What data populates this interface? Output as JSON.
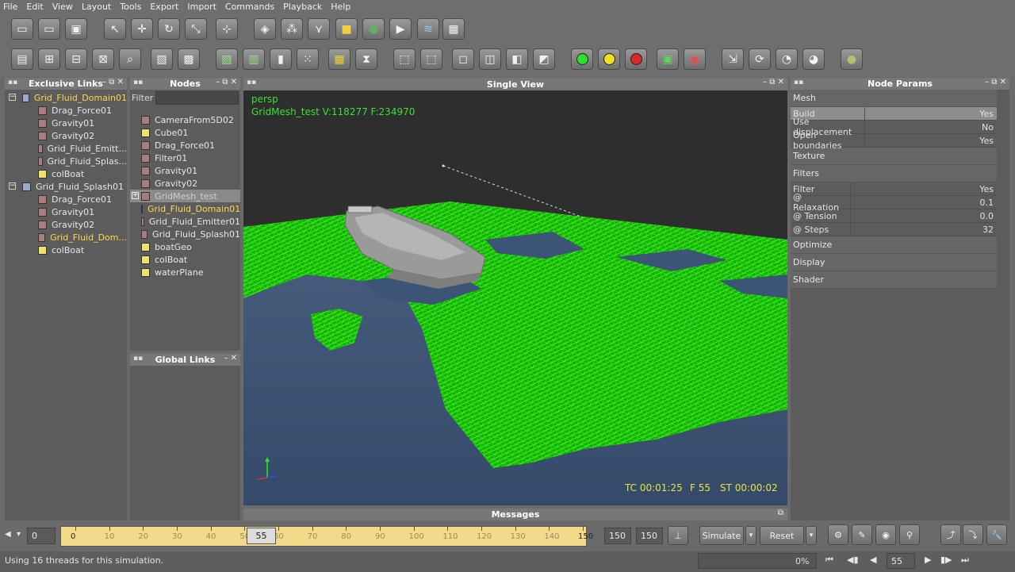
{
  "menu": [
    "File",
    "Edit",
    "View",
    "Layout",
    "Tools",
    "Export",
    "Import",
    "Commands",
    "Playback",
    "Help"
  ],
  "toolbar1_icons": [
    "new-file-icon",
    "open-folder-icon",
    "save-icon",
    "select-arrow-icon",
    "move-icon",
    "rotate-icon",
    "scale-icon",
    "axis-icon",
    "cube-wire-icon",
    "particles-icon",
    "gravity-icon",
    "cube-yellow-icon",
    "sphere-icon",
    "camera-icon",
    "layers-icon",
    "grid-cube-icon"
  ],
  "toolbar2_icons": [
    "table-icon",
    "add-icon",
    "remove-icon",
    "align-icon",
    "zoom-icon",
    "box-icon",
    "box-solid-icon",
    "mesh-icon",
    "grid-icon",
    "panel-icon",
    "dots-icon",
    "cube-grid-icon",
    "hourglass-icon",
    "frame-icon",
    "frame-dashed-icon",
    "view-front-icon",
    "view-side-icon",
    "view-top-icon",
    "view-persp-icon"
  ],
  "colors": {
    "green_light": "#2ee02e",
    "yellow_light": "#f0e020",
    "red_light": "#d82a2a",
    "mesh_green": "#27ff0a",
    "water": "#3c5474",
    "timeline": "#f3d98a"
  },
  "panels": {
    "exclusive_links": {
      "title": "Exclusive Links",
      "groups": [
        {
          "label": "Grid_Fluid_Domain01",
          "items": [
            "Drag_Force01",
            "Gravity01",
            "Gravity02",
            "Grid_Fluid_Emitt...",
            "Grid_Fluid_Splas...",
            "colBoat"
          ]
        },
        {
          "label": "Grid_Fluid_Splash01",
          "items": [
            "Drag_Force01",
            "Gravity01",
            "Gravity02",
            "Grid_Fluid_Dom...",
            "colBoat"
          ]
        }
      ]
    },
    "nodes": {
      "title": "Nodes",
      "filter_label": "Filter",
      "items": [
        "CameraFrom5D02",
        "Cube01",
        "Drag_Force01",
        "Filter01",
        "Gravity01",
        "Gravity02",
        "GridMesh_test",
        "Grid_Fluid_Domain01",
        "Grid_Fluid_Emitter01",
        "Grid_Fluid_Splash01",
        "boatGeo",
        "colBoat",
        "waterPlane"
      ]
    },
    "global_links": {
      "title": "Global Links"
    },
    "single_view": {
      "title": "Single View",
      "camera": "persp",
      "mesh_info": "GridMesh_test V:118277 F:234970",
      "tc": "TC 00:01:25",
      "frame": "F 55",
      "st": "ST 00:00:02"
    },
    "node_params": {
      "title": "Node Params",
      "mesh_section": "Mesh",
      "mesh_rows": [
        {
          "key": "Build",
          "value": "Yes"
        },
        {
          "key": "Use displacement",
          "value": "No"
        },
        {
          "key": "Open boundaries",
          "value": "Yes"
        }
      ],
      "texture_section": "Texture",
      "filters_section": "Filters",
      "filter_rows": [
        {
          "key": "Filter",
          "value": "Yes"
        },
        {
          "key": "@ Relaxation",
          "value": "0.1"
        },
        {
          "key": "@ Tension",
          "value": "0.0"
        },
        {
          "key": "@ Steps",
          "value": "32"
        }
      ],
      "other_sections": [
        "Optimize",
        "Display",
        "Shader"
      ]
    },
    "messages": {
      "title": "Messages"
    }
  },
  "timeline": {
    "start": "0",
    "ticks": [
      "0",
      "10",
      "20",
      "30",
      "40",
      "50",
      "60",
      "70",
      "80",
      "90",
      "100",
      "110",
      "120",
      "130",
      "140",
      "150"
    ],
    "current": "55",
    "end_field": "150",
    "end_field2": "150",
    "simulate_label": "Simulate",
    "reset_label": "Reset"
  },
  "status": {
    "message": "Using 16 threads for this simulation.",
    "progress": "0%",
    "frame_field": "55"
  }
}
